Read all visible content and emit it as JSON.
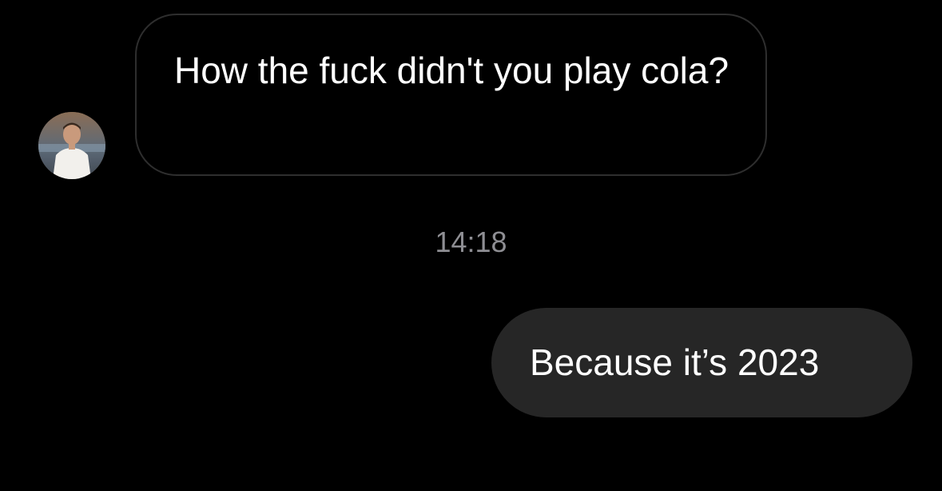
{
  "thread": {
    "messages": [
      {
        "direction": "incoming",
        "text": "How the fuck didn't you play cola?",
        "avatar_icon": "contact-avatar"
      },
      {
        "direction": "outgoing",
        "text": "Because it’s 2023"
      }
    ],
    "timestamp": "14:18"
  },
  "colors": {
    "background": "#000000",
    "incoming_border": "#2e2e2e",
    "outgoing_fill": "#262626",
    "timestamp_text": "#8e8e93",
    "message_text": "#ffffff"
  }
}
